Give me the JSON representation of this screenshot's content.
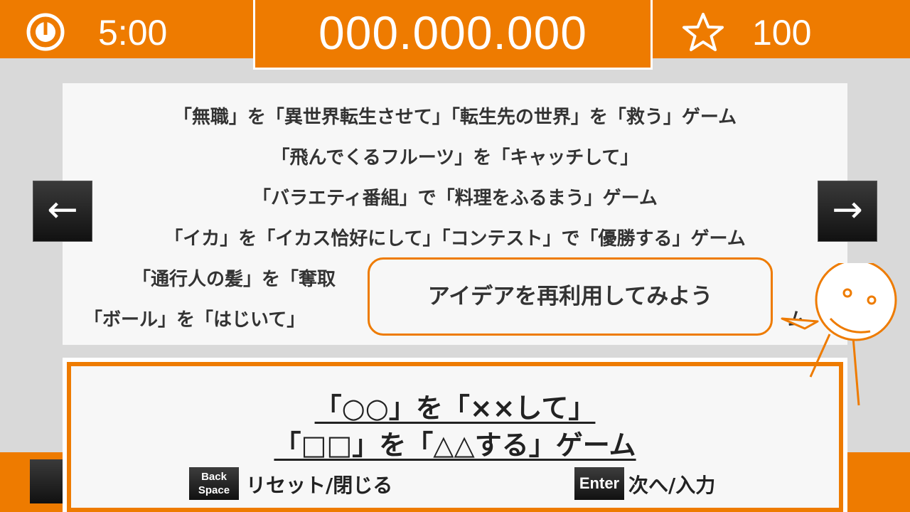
{
  "hud": {
    "timer": "5:00",
    "score": "000.000.000",
    "stars": "100",
    "timer_icon": "clock-icon",
    "star_icon": "star-outline-icon"
  },
  "ideas": {
    "line1": "「無職」を「異世界転生させて」「転生先の世界」を「救う」ゲーム",
    "line2": "「飛んでくるフルーツ」を「キャッチして」",
    "line3": "「バラエティ番組」で「料理をふるまう」ゲーム",
    "line4": "「イカ」を「イカス恰好にして」「コンテスト」で「優勝する」ゲーム",
    "line5": "「通行人の髪」を「奪取",
    "line6": "「ボール」を「はじいて」",
    "line6_tail": "ム"
  },
  "nav": {
    "prev_label": "←",
    "next_label": "→"
  },
  "bubble": {
    "text": "アイデアを再利用してみよう"
  },
  "template": {
    "line1": "「○○」を「××して」",
    "line2": "「□□」を「△△する」ゲーム"
  },
  "controls": {
    "backspace_key_line1": "Back",
    "backspace_key_line2": "Space",
    "backspace_action": "リセット/閉じる",
    "enter_key": "Enter",
    "enter_action": "次へ/入力"
  },
  "colors": {
    "accent": "#ee7b00",
    "background": "#d9d9d9",
    "panel": "#f7f7f7"
  }
}
